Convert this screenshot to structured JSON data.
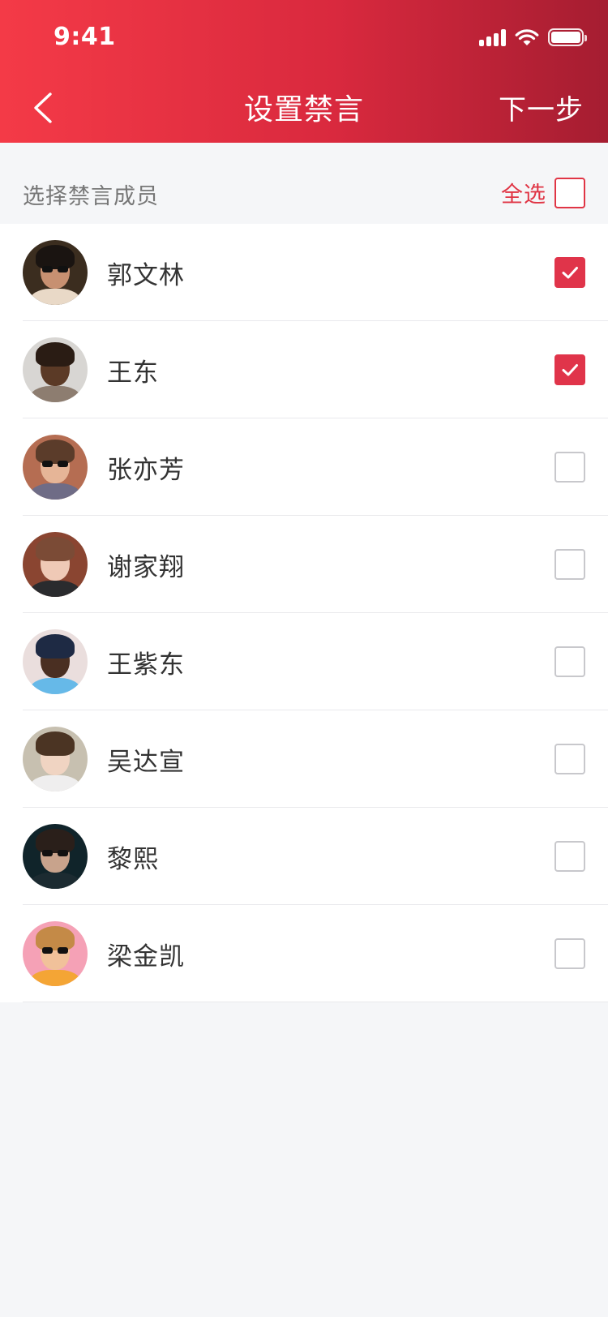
{
  "status_bar": {
    "time": "9:41"
  },
  "nav": {
    "title": "设置禁言",
    "next_label": "下一步"
  },
  "select_bar": {
    "label": "选择禁言成员",
    "select_all_label": "全选",
    "select_all_checked": false
  },
  "members": [
    {
      "name": "郭文林",
      "checked": true,
      "avatar_bg": "#3b2d1f",
      "skin": "#c79071",
      "hair": "#1a1411",
      "shirt": "#e9d9c7",
      "glasses": true
    },
    {
      "name": "王东",
      "checked": true,
      "avatar_bg": "#d8d6d3",
      "skin": "#5b3a26",
      "hair": "#2a1c14",
      "shirt": "#8d7d70",
      "glasses": false
    },
    {
      "name": "张亦芳",
      "checked": false,
      "avatar_bg": "#b56d52",
      "skin": "#e6b597",
      "hair": "#5b3c2a",
      "shirt": "#6f6c86",
      "glasses": true
    },
    {
      "name": "谢家翔",
      "checked": false,
      "avatar_bg": "#8a4531",
      "skin": "#efc9b6",
      "hair": "#7b4b36",
      "shirt": "#2a2b2e",
      "glasses": false
    },
    {
      "name": "王紫东",
      "checked": false,
      "avatar_bg": "#eadedd",
      "skin": "#4a2f22",
      "hair": "#1e2a44",
      "shirt": "#66b9e8",
      "glasses": false
    },
    {
      "name": "吴达宣",
      "checked": false,
      "avatar_bg": "#c7c0b0",
      "skin": "#f0d4c2",
      "hair": "#4b3423",
      "shirt": "#efeeee",
      "glasses": false
    },
    {
      "name": "黎熙",
      "checked": false,
      "avatar_bg": "#10242a",
      "skin": "#c8a38c",
      "hair": "#2a1f1a",
      "shirt": "#1c2b31",
      "glasses": true
    },
    {
      "name": "梁金凯",
      "checked": false,
      "avatar_bg": "#f5a1b6",
      "skin": "#f1c19a",
      "hair": "#c48a47",
      "shirt": "#f4a535",
      "glasses": true
    }
  ],
  "colors": {
    "accent": "#e0344a",
    "header_start": "#f43a47",
    "header_end": "#a51d31"
  }
}
